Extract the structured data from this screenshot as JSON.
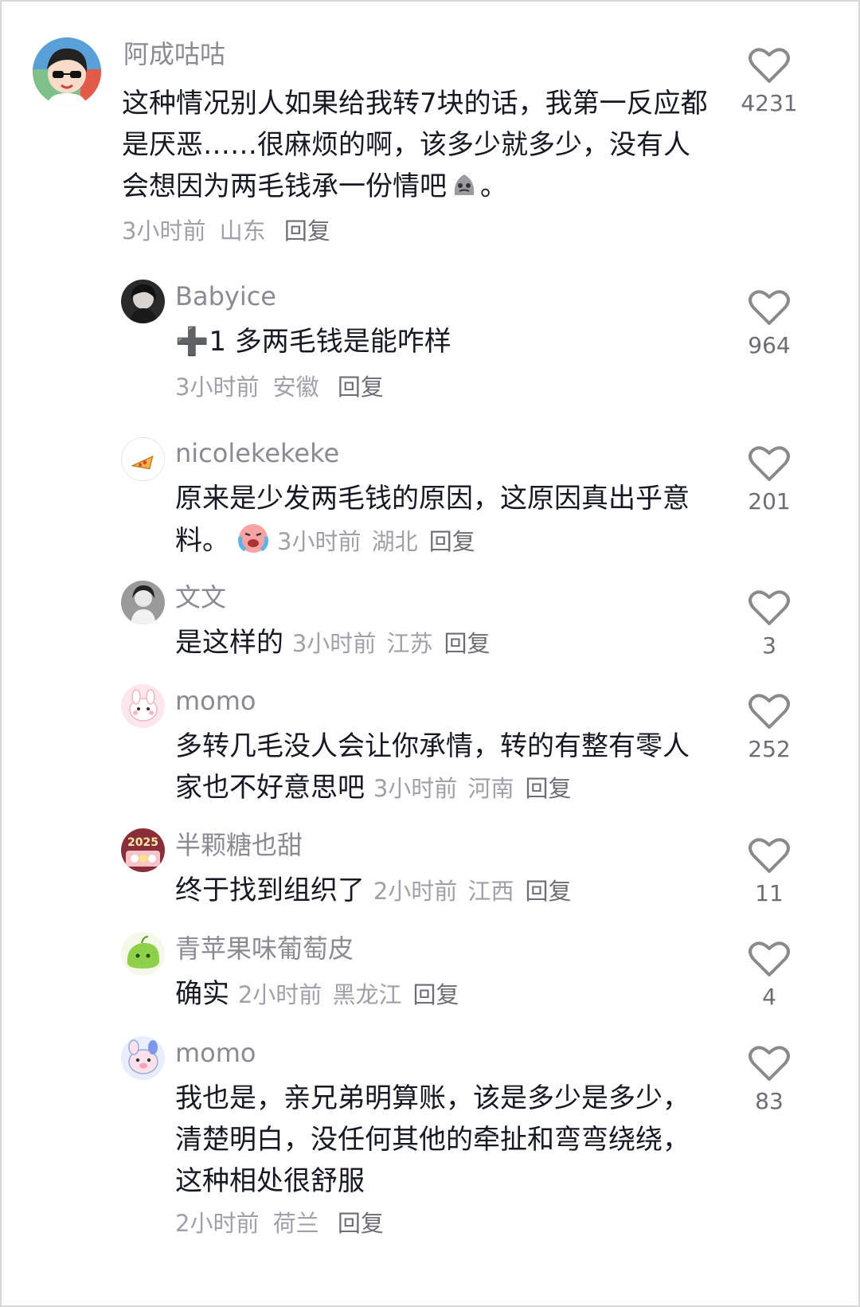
{
  "comments": [
    {
      "username": "阿成咕咕",
      "text": "这种情况别人如果给我转7块的话，我第一反应都是厌恶……很麻烦的啊，该多少就多少，没有人会想因为两毛钱承一份情吧",
      "text_suffix": "。",
      "time": "3小时前",
      "location": "山东",
      "reply_label": "回复",
      "likes": "4231"
    },
    {
      "username": "Babyice",
      "text": "➕1 多两毛钱是能咋样",
      "time": "3小时前",
      "location": "安徽",
      "reply_label": "回复",
      "likes": "964"
    },
    {
      "username": "nicolekekeke",
      "text": "原来是少发两毛钱的原因，这原因真出乎意料。",
      "time": "3小时前",
      "location": "湖北",
      "reply_label": "回复",
      "likes": "201"
    },
    {
      "username": "文文",
      "text": "是这样的",
      "time": "3小时前",
      "location": "江苏",
      "reply_label": "回复",
      "likes": "3"
    },
    {
      "username": "momo",
      "text": "多转几毛没人会让你承情，转的有整有零人家也不好意思吧",
      "time": "3小时前",
      "location": "河南",
      "reply_label": "回复",
      "likes": "252"
    },
    {
      "username": "半颗糖也甜",
      "text": "终于找到组织了",
      "time": "2小时前",
      "location": "江西",
      "reply_label": "回复",
      "likes": "11"
    },
    {
      "username": "青苹果味葡萄皮",
      "text": "确实",
      "time": "2小时前",
      "location": "黑龙江",
      "reply_label": "回复",
      "likes": "4"
    },
    {
      "username": "momo",
      "text": "我也是，亲兄弟明算账，该是多少是多少，清楚明白，没任何其他的牵扯和弯弯绕绕，这种相处很舒服",
      "time": "2小时前",
      "location": "荷兰",
      "reply_label": "回复",
      "likes": "83"
    }
  ],
  "avatars": [
    "avatar-sunglasses",
    "avatar-dark-portrait",
    "avatar-pizza",
    "avatar-bw-girl",
    "avatar-pink-bunny",
    "avatar-2025-badge",
    "avatar-green-blob",
    "avatar-pig-bunny"
  ],
  "icons": {
    "like": "heart-outline-icon",
    "emoji_crying": "crying-face-emoji",
    "emoji_gray": "gray-blob-emoji"
  },
  "avatar_year": "2025",
  "colors": {
    "username": "#8a8b91",
    "text": "#161823",
    "meta": "#a0a1a6",
    "reply": "#6d6e73",
    "like_icon": "#8a8a8a"
  }
}
